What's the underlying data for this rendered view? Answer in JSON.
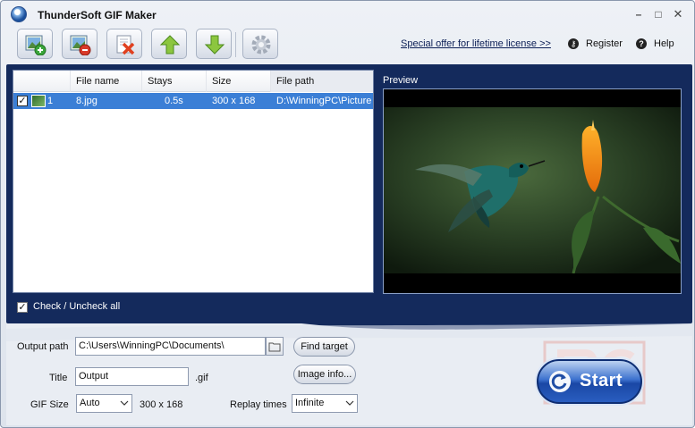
{
  "app": {
    "title": "ThunderSoft GIF Maker"
  },
  "window_controls": {
    "minimize": "–",
    "maximize": "□",
    "close": "✕"
  },
  "toolbar": {
    "buttons": [
      {
        "icon": "add-image-icon"
      },
      {
        "icon": "remove-image-icon"
      },
      {
        "icon": "clear-list-icon"
      },
      {
        "icon": "move-up-icon"
      },
      {
        "icon": "move-down-icon"
      },
      {
        "icon": "settings-gear-icon"
      }
    ],
    "special_offer": "Special offer for lifetime license >>",
    "register": "Register",
    "help": "Help"
  },
  "file_list": {
    "columns": [
      "",
      "File name",
      "Stays",
      "Size",
      "File path"
    ],
    "rows": [
      {
        "checked": true,
        "index": "1",
        "file_name": "8.jpg",
        "stays": "0.5s",
        "size": "300 x 168",
        "path": "D:\\WinningPC\\Picture\\"
      }
    ]
  },
  "preview": {
    "label": "Preview"
  },
  "check_all": {
    "label": "Check / Uncheck all",
    "checked": true
  },
  "output": {
    "path_label": "Output path",
    "path_value": "C:\\Users\\WinningPC\\Documents\\",
    "find_target": "Find target",
    "title_label": "Title",
    "title_value": "Output",
    "title_ext": ".gif",
    "image_info": "Image info...",
    "gif_size_label": "GIF Size",
    "gif_size_value": "Auto",
    "gif_dims": "300 x 168",
    "replay_label": "Replay times",
    "replay_value": "Infinite"
  },
  "start": {
    "label": "Start"
  },
  "colors": {
    "panel": "#142a5c",
    "selection": "#3b7fd6",
    "start": "#1a47a5"
  }
}
